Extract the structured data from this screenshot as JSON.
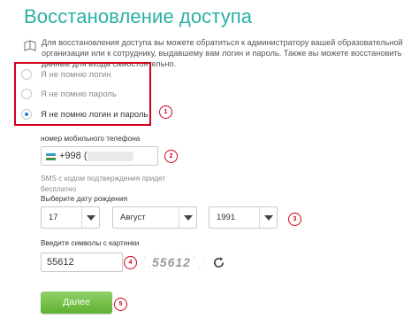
{
  "header": {
    "title": "Восстановление доступа"
  },
  "info": {
    "icon": "book-icon",
    "text": "Для восстановления доступа вы можете обратиться к администратору вашей образовательной организации или к сотруднику, выдавшему вам логин и пароль. Также вы можете восстановить данные для входа самостоятельно."
  },
  "recovery_options": [
    {
      "label": "Я не помню логин",
      "checked": false
    },
    {
      "label": "Я не помню пароль",
      "checked": false
    },
    {
      "label": "Я не помню логин и пароль",
      "checked": true
    }
  ],
  "phone": {
    "label": "номер мобильного телефона",
    "prefix": "+998 ( 90"
  },
  "sms_note": "SMS с кодом подтверждения придет бесплатно",
  "birth_date": {
    "label": "Выберите дату рождения",
    "day": "17",
    "month": "Август",
    "year": "1991"
  },
  "captcha": {
    "label": "Введите символы с картинки",
    "value": "55612",
    "image_text": "55612"
  },
  "submit_label": "Далее",
  "badges": [
    "1",
    "2",
    "3",
    "4",
    "5"
  ],
  "colors": {
    "title": "#2ab0a6",
    "highlight": "#d0021b",
    "button": "#6fbf3c",
    "radio_selected": "#2a7ad5"
  }
}
